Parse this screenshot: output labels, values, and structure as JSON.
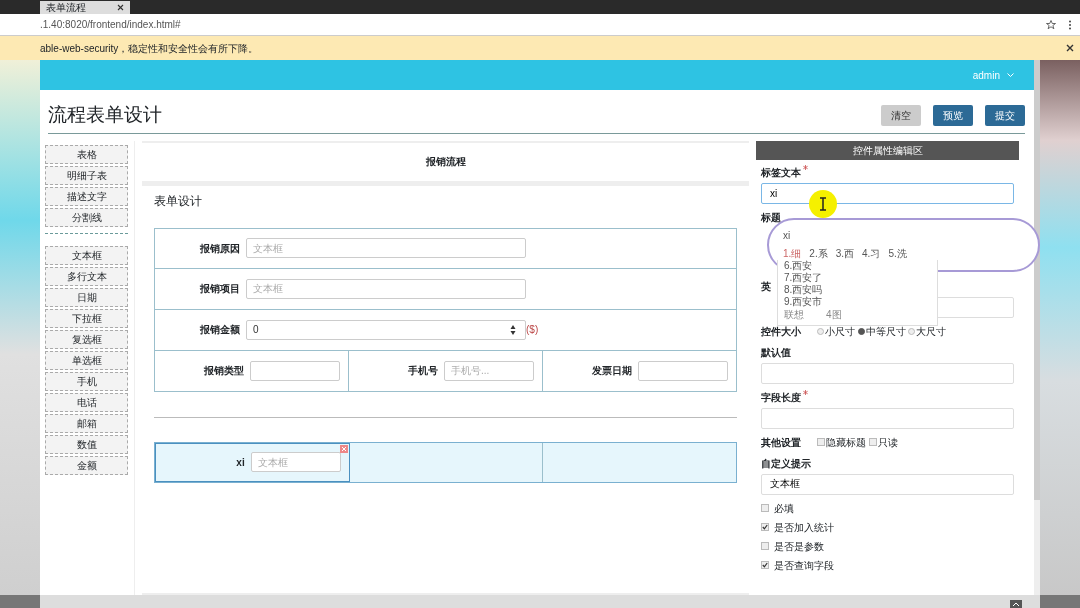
{
  "browser": {
    "tab_title": "表单流程",
    "url": ".1.40:8020/frontend/index.html#",
    "info_bar": "able-web-security，稳定性和安全性会有所下降。"
  },
  "navbar": {
    "user": "admin"
  },
  "page": {
    "title": "流程表单设计",
    "buttons": [
      {
        "label": "清空",
        "kind": "secondary"
      },
      {
        "label": "预览",
        "kind": "primary"
      },
      {
        "label": "提交",
        "kind": "primary"
      }
    ]
  },
  "palette": {
    "groups": [
      {
        "items": [
          "表格",
          "明细子表",
          "描述文字",
          "分割线"
        ]
      },
      {
        "items": [
          "文本框",
          "多行文本",
          "日期",
          "下拉框",
          "复选框",
          "单选框",
          "手机",
          "电话",
          "邮箱",
          "数值",
          "金额"
        ]
      }
    ]
  },
  "form": {
    "title": "报销流程",
    "section": "表单设计",
    "rows": [
      {
        "selected": false,
        "cells": [
          {
            "kind": "text",
            "label": "报销原因",
            "placeholder": "文本框"
          }
        ]
      },
      {
        "selected": false,
        "cells": [
          {
            "kind": "text",
            "label": "报销项目",
            "placeholder": "文本框"
          }
        ]
      },
      {
        "selected": false,
        "cells": [
          {
            "kind": "number",
            "label": "报销金额",
            "value": "0",
            "suffix": "($)"
          }
        ]
      },
      {
        "selected": false,
        "cells": [
          {
            "kind": "text",
            "label": "报销类型"
          },
          {
            "kind": "text",
            "label": "手机号",
            "placeholder": "手机号..."
          },
          {
            "kind": "text",
            "label": "发票日期"
          }
        ]
      },
      {
        "kind": "divider"
      },
      {
        "selected": true,
        "cells": [
          {
            "kind": "text",
            "label": "xi",
            "placeholder": "文本框",
            "selected": true
          },
          {
            "kind": "empty"
          },
          {
            "kind": "empty"
          }
        ]
      }
    ]
  },
  "properties": {
    "title": "控件属性编辑区",
    "fields": [
      {
        "kind": "input",
        "label": "标签文本",
        "required": true,
        "value": "xi",
        "focused": true
      },
      {
        "kind": "covered",
        "label": "标题"
      },
      {
        "kind": "input",
        "label": "英",
        "required": false,
        "focused": false
      },
      {
        "kind": "radio",
        "label": "控件大小",
        "options": [
          {
            "label": "小尺寸",
            "selected": false
          },
          {
            "label": "中等尺寸",
            "selected": true
          },
          {
            "label": "大尺寸",
            "selected": false
          }
        ]
      },
      {
        "kind": "input",
        "label": "默认值",
        "required": false,
        "focused": false
      },
      {
        "kind": "input",
        "label": "字段长度",
        "required": true,
        "focused": false
      },
      {
        "kind": "inline_checks",
        "label": "其他设置",
        "options": [
          {
            "label": "隐藏标题",
            "checked": false
          },
          {
            "label": "只读",
            "checked": false
          }
        ]
      },
      {
        "kind": "input",
        "label": "自定义提示",
        "required": false,
        "value": "文本框",
        "focused": false
      },
      {
        "kind": "checks",
        "options": [
          {
            "label": "必填",
            "checked": false
          },
          {
            "label": "是否加入统计",
            "checked": true
          },
          {
            "label": "是否是参数",
            "checked": false
          },
          {
            "label": "是否查询字段",
            "checked": true
          }
        ]
      }
    ]
  },
  "ime": {
    "input": "xi",
    "candidates": [
      {
        "label": "1.细",
        "selected": true
      },
      {
        "label": "2.系",
        "selected": false
      },
      {
        "label": "3.西",
        "selected": false
      },
      {
        "label": "4.习",
        "selected": false
      },
      {
        "label": "5.洗",
        "selected": false
      }
    ],
    "more": [
      "6.西安",
      "7.西安了",
      "8.西安吗",
      "9.西安市"
    ],
    "footer": [
      "联想",
      "4图"
    ]
  }
}
